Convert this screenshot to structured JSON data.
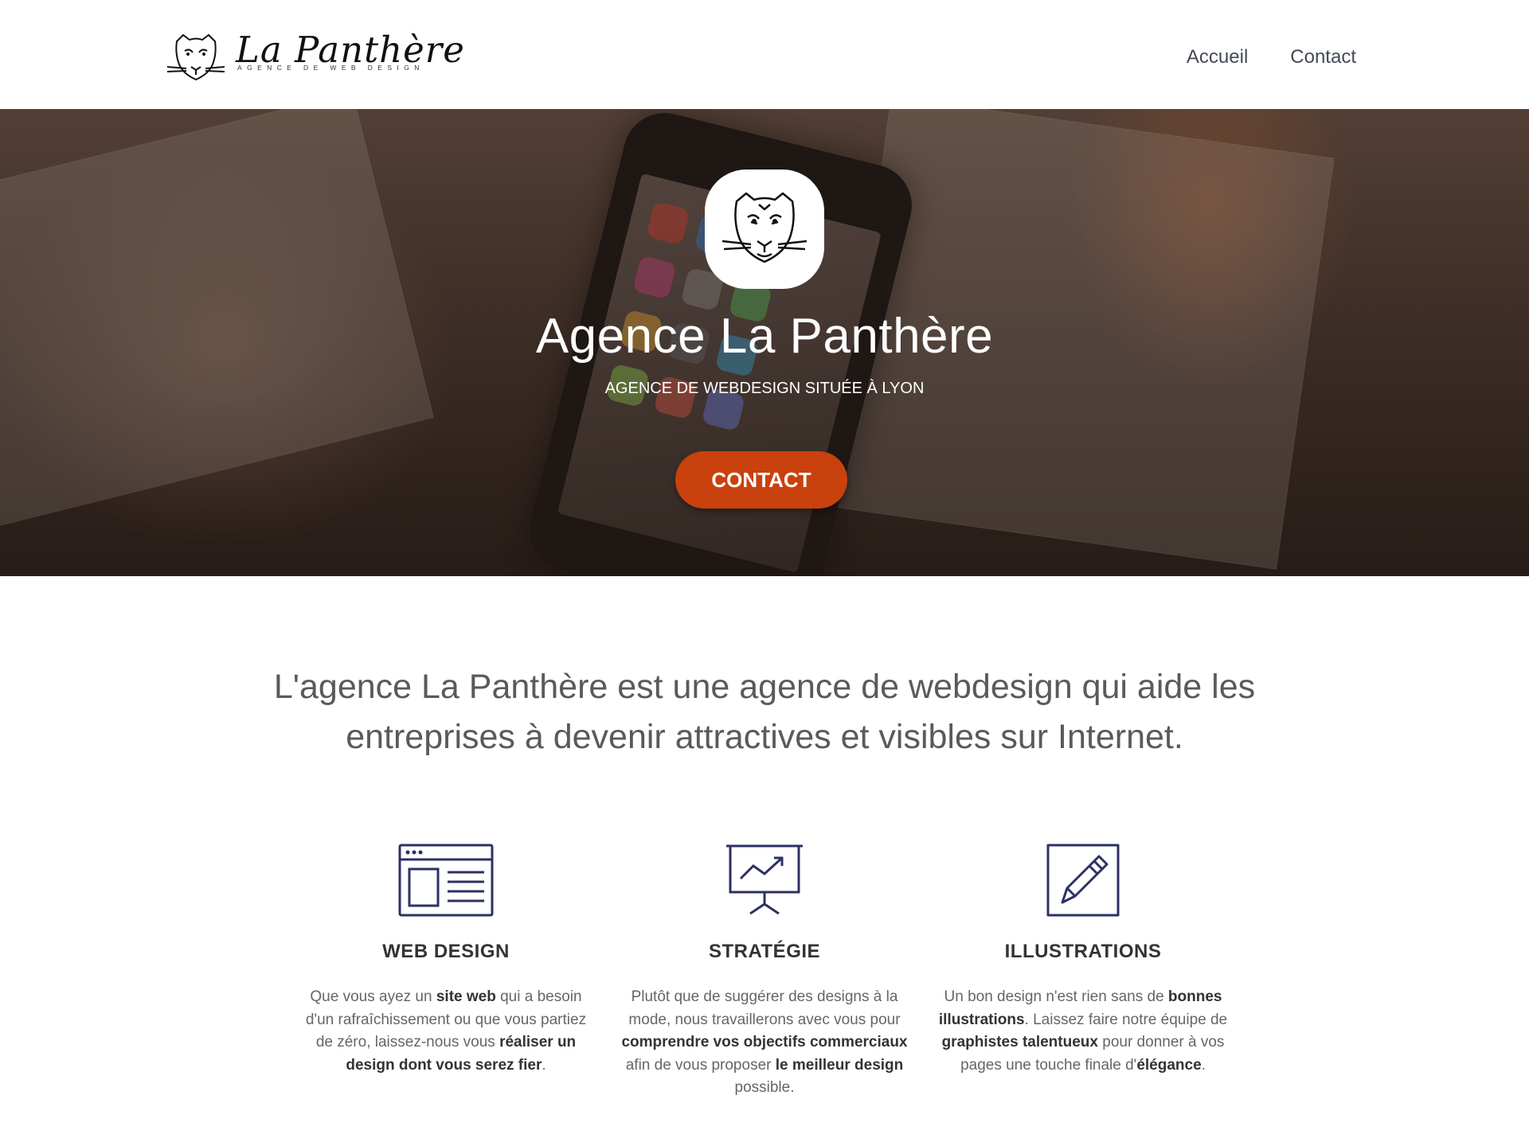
{
  "header": {
    "logo_title": "La Panthère",
    "logo_subtitle": "AGENCE DE WEB DESIGN",
    "nav": [
      {
        "label": "Accueil"
      },
      {
        "label": "Contact"
      }
    ]
  },
  "hero": {
    "title": "Agence La Panthère",
    "subtitle": "AGENCE DE WEBDESIGN SITUÉE À LYON",
    "button_label": "CONTACT",
    "button_color": "#c9410d"
  },
  "intro": {
    "text": "L'agence La Panthère est une agence de webdesign qui aide les entreprises à devenir attractives et visibles sur Internet."
  },
  "features": [
    {
      "icon": "browser-window-icon",
      "title": "WEB DESIGN",
      "parts": [
        {
          "text": "Que vous ayez un ",
          "bold": false
        },
        {
          "text": "site web",
          "bold": true
        },
        {
          "text": " qui a besoin d'un rafraîchissement ou que vous partiez de zéro, laissez-nous vous ",
          "bold": false
        },
        {
          "text": "réaliser un design dont vous serez fier",
          "bold": true
        },
        {
          "text": ".",
          "bold": false
        }
      ]
    },
    {
      "icon": "presentation-chart-icon",
      "title": "STRATÉGIE",
      "parts": [
        {
          "text": "Plutôt que de suggérer des designs à la mode, nous travaillerons avec vous pour ",
          "bold": false
        },
        {
          "text": "comprendre vos objectifs commerciaux",
          "bold": true
        },
        {
          "text": " afin de vous proposer ",
          "bold": false
        },
        {
          "text": "le meilleur design",
          "bold": true
        },
        {
          "text": " possible.",
          "bold": false
        }
      ]
    },
    {
      "icon": "pencil-edit-icon",
      "title": "ILLUSTRATIONS",
      "parts": [
        {
          "text": "Un bon design n'est rien sans de ",
          "bold": false
        },
        {
          "text": "bonnes illustrations",
          "bold": true
        },
        {
          "text": ". Laissez faire notre équipe de ",
          "bold": false
        },
        {
          "text": "graphistes talentueux",
          "bold": true
        },
        {
          "text": " pour donner à vos pages une touche finale d'",
          "bold": false
        },
        {
          "text": "élégance",
          "bold": true
        },
        {
          "text": ".",
          "bold": false
        }
      ]
    }
  ],
  "colors": {
    "accent": "#c9410d",
    "icon_stroke": "#2c3064",
    "text": "#555555"
  }
}
